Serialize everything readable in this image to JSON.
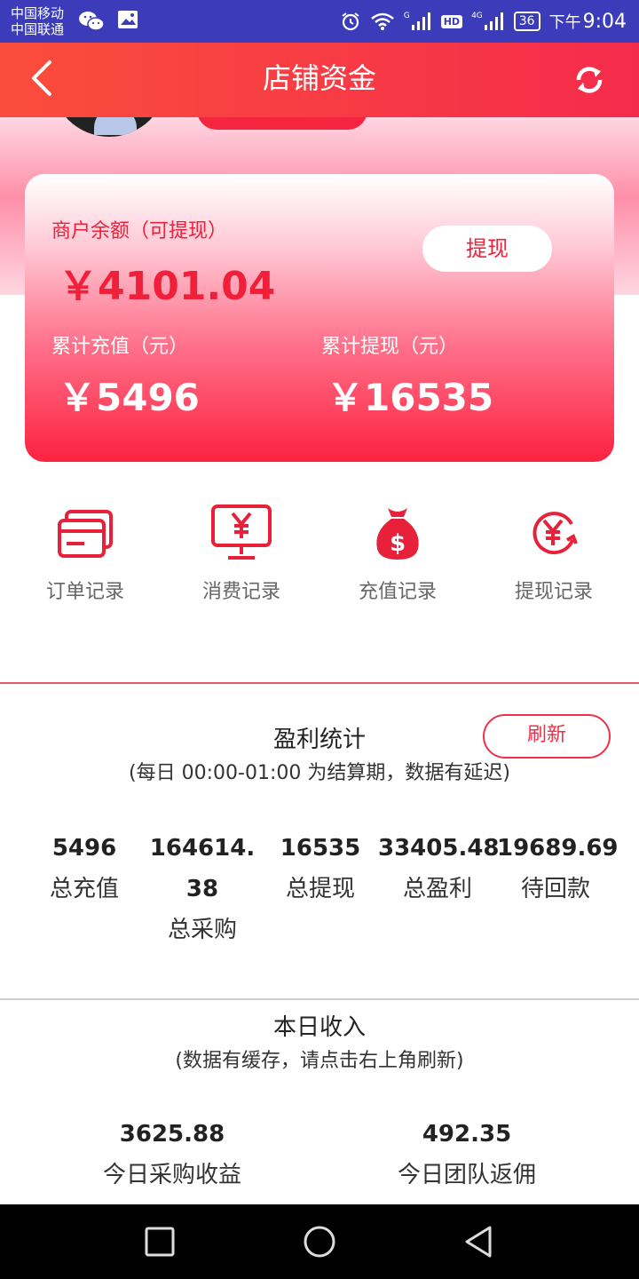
{
  "status_bar": {
    "carrier_1": "中国移动",
    "carrier_2": "中国联通",
    "signal_1": "G",
    "signal_2": "4G",
    "hd": "HD",
    "battery": "36",
    "ampm": "下午",
    "time": "9:04"
  },
  "header": {
    "title": "店铺资金"
  },
  "balance": {
    "merchant_label": "商户余额（可提现）",
    "merchant_value": "￥4101.04",
    "withdraw_button": "提现",
    "recharge_label": "累计充值（元）",
    "recharge_value": "￥5496",
    "withdrawn_label": "累计提现（元）",
    "withdrawn_value": "￥16535"
  },
  "quick_links": [
    {
      "label": "订单记录",
      "icon": "card-icon"
    },
    {
      "label": "消费记录",
      "icon": "monitor-yen-icon"
    },
    {
      "label": "充值记录",
      "icon": "money-bag-icon"
    },
    {
      "label": "提现记录",
      "icon": "yen-refresh-icon"
    }
  ],
  "profit": {
    "title": "盈利统计",
    "subtitle": "(每日 00:00-01:00 为结算期，数据有延迟)",
    "refresh_button": "刷新",
    "stats": [
      {
        "value": "5496",
        "label": "总充值"
      },
      {
        "value": "164614.38",
        "label": "总采购"
      },
      {
        "value": "16535",
        "label": "总提现"
      },
      {
        "value": "33405.48",
        "label": "总盈利"
      },
      {
        "value": "19689.69",
        "label": "待回款"
      }
    ]
  },
  "today": {
    "title": "本日收入",
    "subtitle": "(数据有缓存，请点击右上角刷新)",
    "stats": [
      {
        "value": "3625.88",
        "label": "今日采购收益"
      },
      {
        "value": "492.35",
        "label": "今日团队返佣"
      }
    ]
  },
  "colors": {
    "accent": "#f0203a",
    "status_bar": "#3c3cba",
    "nav_bar": "#000000"
  }
}
